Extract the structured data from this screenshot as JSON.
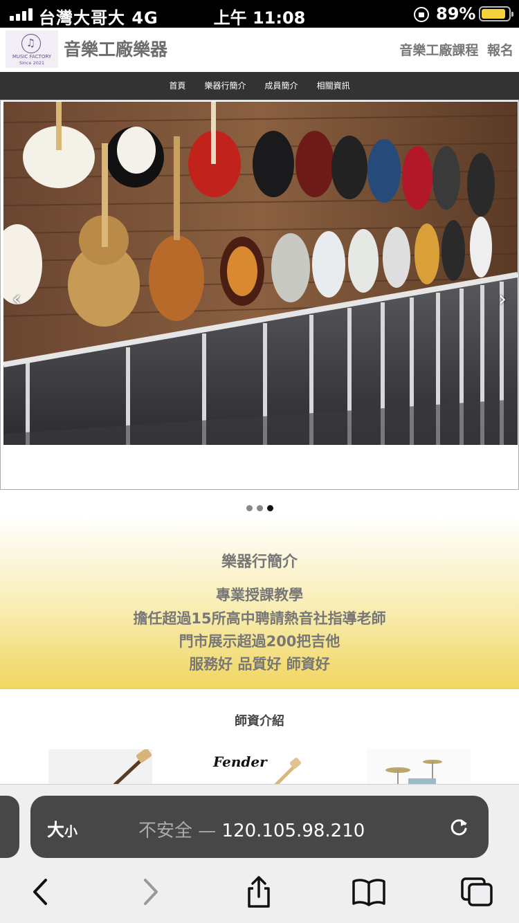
{
  "status_bar": {
    "carrier": "台灣大哥大  4G",
    "time": "上午 11:08",
    "battery_percent": "89%",
    "battery_color": "#f5d23b"
  },
  "header": {
    "logo_line1": "MUSIC FACTORY",
    "logo_line2": "Since 2021",
    "site_title": "音樂工廠樂器",
    "link_courses": "音樂工廠課程",
    "link_register": "報名"
  },
  "nav": {
    "items": [
      "首頁",
      "樂器行簡介",
      "成員簡介",
      "相關資訊"
    ],
    "background": "#333333"
  },
  "carousel": {
    "slide_count": 3,
    "active_slide": 3,
    "prev_icon": "chevron-left-icon",
    "next_icon": "chevron-right-icon"
  },
  "intro": {
    "title": "樂器行簡介",
    "lines": [
      "專業授課教學",
      "擔任超過15所高中聘請熱音社指導老師",
      "門市展示超過200把吉他",
      "服務好 品質好 師資好"
    ]
  },
  "teachers": {
    "title": "師資介紹",
    "fender_logo_text": "Fender"
  },
  "browser": {
    "text_size_label_big": "大",
    "text_size_label_small": "小",
    "not_secure_label": "不安全 —",
    "url": "120.105.98.210",
    "toolbar_icons": [
      "back-icon",
      "forward-icon",
      "share-icon",
      "bookmarks-icon",
      "tabs-icon"
    ]
  }
}
